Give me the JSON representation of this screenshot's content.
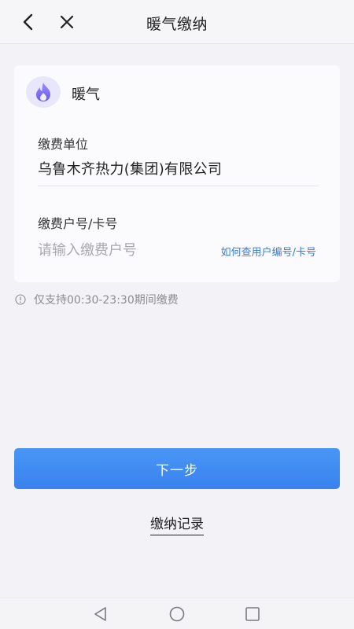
{
  "header": {
    "title": "暖气缴纳",
    "back_icon": "chevron-left-icon",
    "close_icon": "close-icon"
  },
  "service": {
    "name": "暖气",
    "icon": "flame-icon",
    "icon_color": "#7a6df0"
  },
  "form": {
    "unit_label": "缴费单位",
    "unit_value": "乌鲁木齐热力(集团)有限公司",
    "account_label": "缴费户号/卡号",
    "account_placeholder": "请输入缴费户号",
    "account_value": "",
    "help_link": "如何查用户编号/卡号"
  },
  "notice": {
    "icon": "info-circle-icon",
    "text": "仅支持00:30-23:30期间缴费"
  },
  "actions": {
    "next_label": "下一步",
    "records_label": "缴纳记录"
  },
  "navbar": {
    "back": "triangle-back-icon",
    "home": "circle-home-icon",
    "recent": "square-recent-icon"
  },
  "colors": {
    "accent": "#3f8af2",
    "link": "#3a7bd5",
    "background": "#f2f2f7"
  }
}
